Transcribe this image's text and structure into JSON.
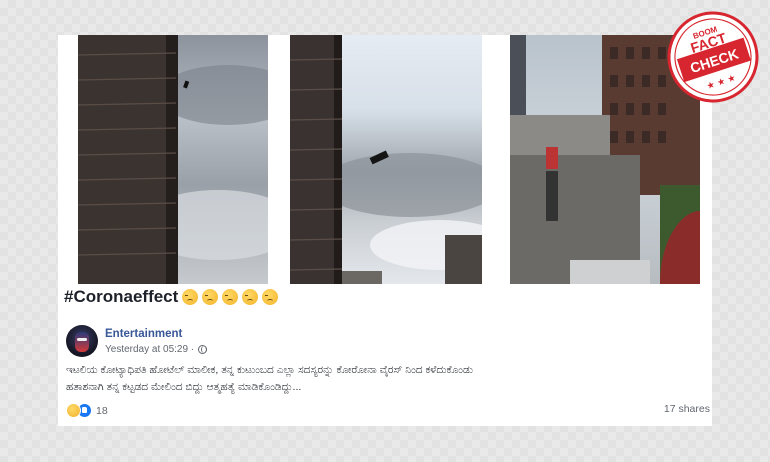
{
  "caption": {
    "title": "#Coronaeffect",
    "emojis": [
      "sad-face",
      "sad-face",
      "sad-face",
      "sad-face",
      "sad-face"
    ]
  },
  "post": {
    "page_name": "Entertainment",
    "timestamp": "Yesterday at 05:29 ·",
    "text_line1": "ಇಟಲಿಯ ಕೋಟ್ಯಾಧಿಪತಿ ಹೋಟೆಲ್ ಮಾಲೀಕ, ತನ್ನ ಕುಟುಂಬದ ಎಲ್ಲಾ ಸದಸ್ಯರನ್ನು ಕೋರೋನಾ ವೈರಸ್ ನಿಂದ ಕಳೆದುಕೊಂಡು",
    "text_line2": "ಹತಾಶನಾಗಿ ತನ್ನ ಕಟ್ಟಡದ ಮೇಲಿಂದ ಬಿದ್ದು ಆತ್ಮಹತ್ಯೆ ಮಾಡಿಕೊಂಡಿದ್ದು..."
  },
  "footer": {
    "reaction_count": "18",
    "shares": "17 shares"
  },
  "badge": {
    "brand": "BOOM",
    "word1": "FACT",
    "word2": "CHECK",
    "color": "#d7262f"
  },
  "colors": {
    "link": "#385898",
    "text": "#1d2129",
    "muted": "#616770"
  }
}
